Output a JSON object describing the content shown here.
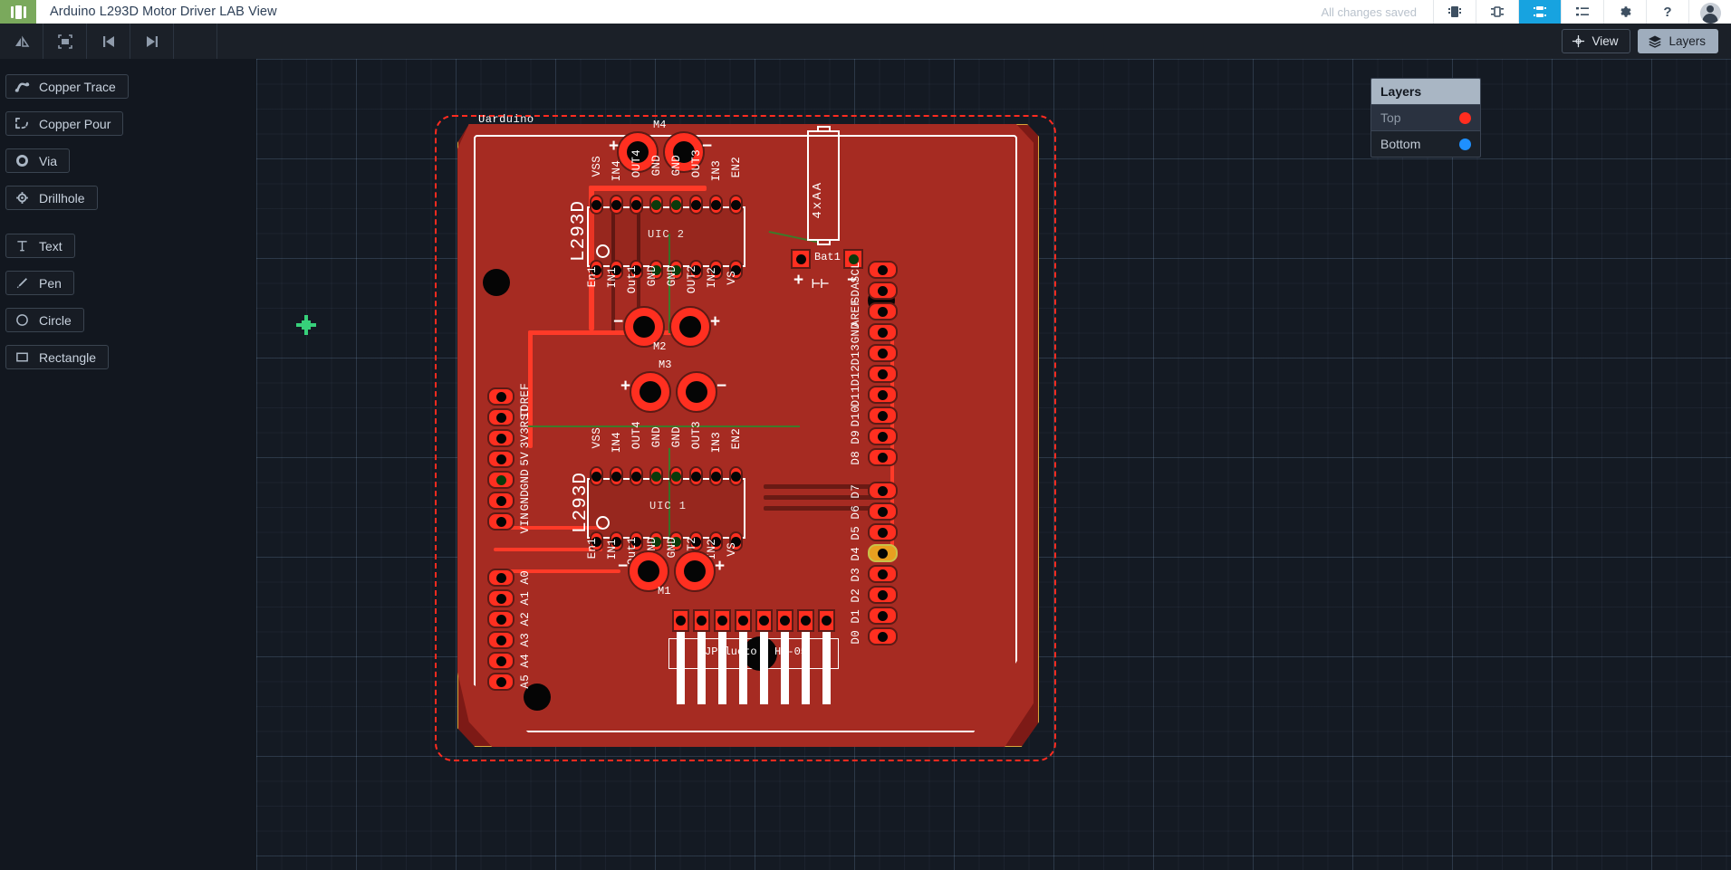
{
  "appbar": {
    "logo": "app-logo",
    "title": "Arduino L293D Motor Driver LAB View",
    "save_status": "All changes saved",
    "buttons": [
      {
        "name": "schematic-view-button",
        "icon": "chip-icon",
        "active": false
      },
      {
        "name": "pcb-footprint-button",
        "icon": "ic-pins-icon",
        "active": false
      },
      {
        "name": "pcb-view-button",
        "icon": "pcb-icon",
        "active": true
      },
      {
        "name": "bom-list-button",
        "icon": "list-icon",
        "active": false
      },
      {
        "name": "settings-button",
        "icon": "gear-icon",
        "active": false
      },
      {
        "name": "help-button",
        "icon": "question-icon",
        "active": false
      }
    ],
    "avatar": "user-avatar"
  },
  "toolbar": {
    "buttons": [
      {
        "name": "flip-board-button",
        "icon": "flip-icon"
      },
      {
        "name": "fit-to-screen-button",
        "icon": "fit-screen-icon"
      },
      {
        "name": "step-back-button",
        "icon": "skip-back-icon"
      },
      {
        "name": "step-forward-button",
        "icon": "skip-forward-icon"
      }
    ],
    "view_label": "View",
    "layers_label": "Layers"
  },
  "palette": {
    "tools": [
      {
        "label": "Copper Trace",
        "icon": "copper-trace-icon"
      },
      {
        "label": "Copper Pour",
        "icon": "copper-pour-icon"
      },
      {
        "label": "Via",
        "icon": "via-icon"
      },
      {
        "label": "Drillhole",
        "icon": "drillhole-icon"
      },
      {
        "label": "Text",
        "icon": "text-icon"
      },
      {
        "label": "Pen",
        "icon": "pen-icon"
      },
      {
        "label": "Circle",
        "icon": "circle-icon"
      },
      {
        "label": "Rectangle",
        "icon": "rectangle-icon"
      }
    ]
  },
  "layers_panel": {
    "title": "Layers",
    "layers": [
      {
        "label": "Top",
        "color": "#ff2d1f",
        "selected": true
      },
      {
        "label": "Bottom",
        "color": "#1e90ff",
        "selected": false
      }
    ]
  },
  "board": {
    "silkscreen_name": "Uarduino",
    "ics": [
      {
        "designator": "UIC  2",
        "part": "L293D"
      },
      {
        "designator": "UIC  1",
        "part": "L293D"
      }
    ],
    "ic_top_pins": [
      "VSS",
      "IN4",
      "OUT4",
      "GND",
      "GND",
      "OUT3",
      "IN3",
      "EN2"
    ],
    "ic_bottom_pins": [
      "En1",
      "IN1",
      "Out1",
      "GND",
      "GND",
      "OUT2",
      "IN2",
      "VS"
    ],
    "motor_terminals": [
      "M4",
      "M2",
      "M3",
      "M1"
    ],
    "polarity": {
      "plus": "+",
      "minus": "−"
    },
    "battery": {
      "designator": "Bat1",
      "label": "4xAA"
    },
    "bluetooth": {
      "designator": "JPBlueto",
      "part": "HC-05"
    },
    "header_power": [
      "IOREF",
      "RST",
      "3V3",
      "5V",
      "GND",
      "GND",
      "VIN"
    ],
    "header_analog": [
      "A0",
      "A1",
      "A2",
      "A3",
      "A4",
      "A5"
    ],
    "header_digital_high": [
      "SCL",
      "SDA",
      "AREF",
      "GND",
      "D13",
      "D12",
      "D11",
      "D10",
      "D9",
      "D8"
    ],
    "header_digital_low": [
      "D7",
      "D6",
      "D5",
      "D4",
      "D3",
      "D2",
      "D1",
      "D0"
    ],
    "selected_pad": "D4"
  }
}
